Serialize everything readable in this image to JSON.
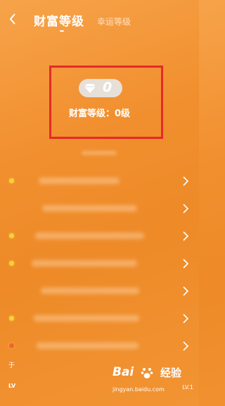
{
  "header": {
    "back_icon": "chevron-left-icon",
    "active_tab": "财富等级",
    "other_tab": "幸运等级"
  },
  "wealth_card": {
    "badge_icon": "diamond-icon",
    "badge_value": "0",
    "level_text": "财富等级：0级"
  },
  "list": {
    "rows": [
      {
        "has_dot": true
      },
      {
        "has_dot": false
      },
      {
        "has_dot": true
      },
      {
        "has_dot": true
      },
      {
        "has_dot": false
      },
      {
        "has_dot": true
      },
      {
        "has_dot": true
      }
    ]
  },
  "bottom": {
    "left_char": "于",
    "lv_left": "LV",
    "lv_right": "LV.1"
  },
  "watermark": {
    "logo_text": "Bai",
    "logo_text2": "经验",
    "url": "jingyan.baidu.com"
  },
  "colors": {
    "background": "#f18f2e",
    "highlight_border": "#e42a2a",
    "dot": "#f6d23a"
  }
}
